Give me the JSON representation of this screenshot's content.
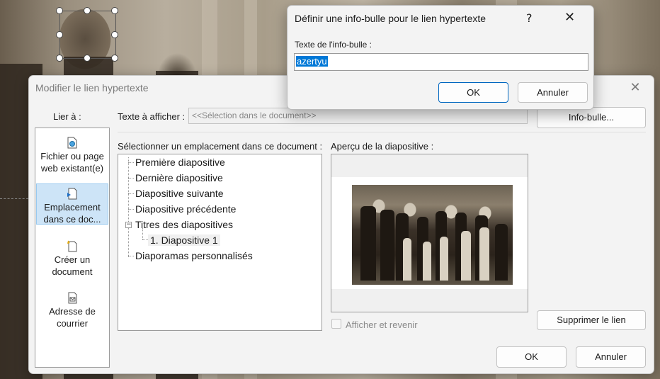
{
  "main_dialog": {
    "title": "Modifier le lien hypertexte",
    "close_glyph": "✕",
    "lie_a_label": "Lier à :",
    "link_types": [
      {
        "label": "Fichier ou page web existant(e)",
        "icon": "web-page-icon"
      },
      {
        "label": "Emplacement dans ce doc...",
        "icon": "document-place-icon",
        "active": true
      },
      {
        "label": "Créer un document",
        "icon": "new-document-icon"
      },
      {
        "label": "Adresse de courrier",
        "icon": "mail-icon"
      }
    ],
    "text_to_display_label": "Texte à afficher :",
    "text_to_display_value": "<<Sélection dans le document>>",
    "info_bulle_button": "Info-bulle...",
    "select_location_label": "Sélectionner un emplacement dans ce document :",
    "preview_label": "Aperçu de la diapositive :",
    "tree": {
      "items": [
        "Première diapositive",
        "Dernière diapositive",
        "Diapositive suivante",
        "Diapositive précédente",
        "Titres des diapositives",
        "1. Diapositive 1",
        "Diaporamas personnalisés"
      ],
      "expander_glyph": "−"
    },
    "show_and_return_label": "Afficher et revenir",
    "remove_link_button": "Supprimer le lien",
    "ok_button": "OK",
    "cancel_button": "Annuler"
  },
  "tooltip_dialog": {
    "title": "Définir une info-bulle pour le lien hypertexte",
    "help_glyph": "?",
    "close_glyph": "✕",
    "field_label": "Texte de l'info-bulle :",
    "field_value": "azertyu",
    "ok_button": "OK",
    "cancel_button": "Annuler"
  },
  "colors": {
    "accent": "#0078d7",
    "selection_highlight": "#cde4f7"
  }
}
